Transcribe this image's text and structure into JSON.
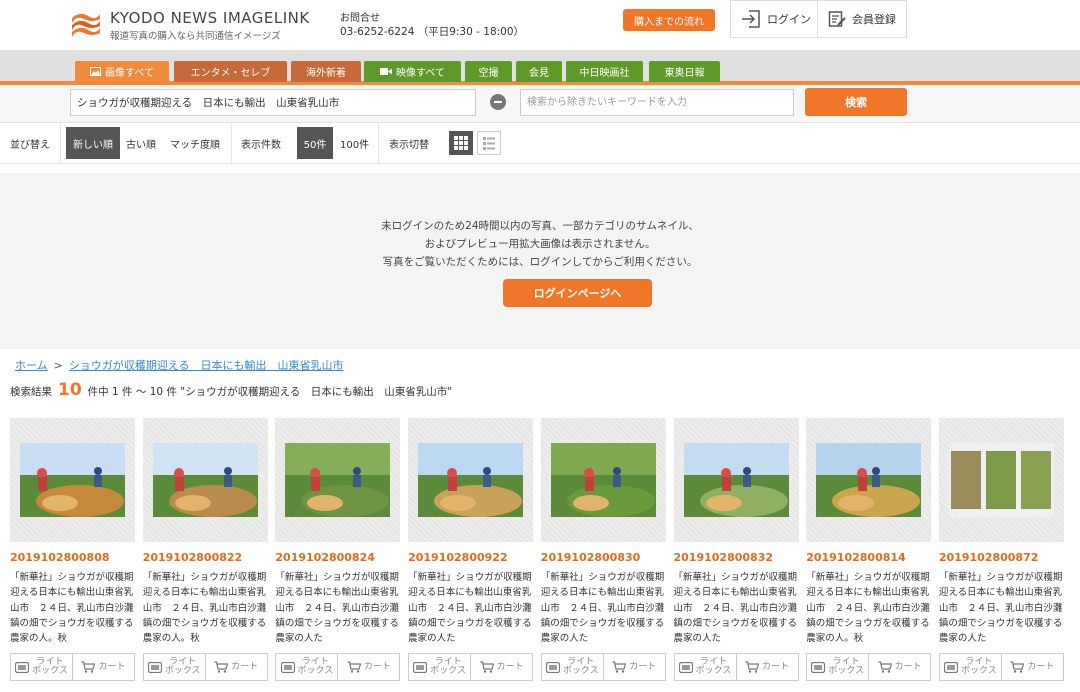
{
  "header": {
    "logo_title": "KYODO NEWS IMAGELINK",
    "logo_subtitle": "報道写真の購入なら共同通信イメージズ",
    "contact_label": "お問合せ",
    "contact_phone": "03-6252-6224 （平日9:30 - 18:00）",
    "flow_button": "購入までの流れ",
    "login": "ログイン",
    "register": "会員登録"
  },
  "categories": [
    {
      "label": "画像すべて",
      "color": "#f08a3c",
      "icon": "image-icon"
    },
    {
      "label": "エンタメ・セレブ",
      "color": "#c66a3a",
      "icon": ""
    },
    {
      "label": "海外新着",
      "color": "#c66a3a",
      "icon": ""
    },
    {
      "label": "映像すべて",
      "color": "#5d9a2a",
      "icon": "video-icon"
    },
    {
      "label": "空撮",
      "color": "#5d9a2a",
      "icon": ""
    },
    {
      "label": "会見",
      "color": "#5d9a2a",
      "icon": ""
    },
    {
      "label": "中日映画社",
      "color": "#5d9a2a",
      "icon": ""
    },
    {
      "label": "東奥日報",
      "color": "#5d9a2a",
      "icon": ""
    }
  ],
  "search": {
    "query": "ショウガが収穫期迎える　日本にも輸出　山東省乳山市",
    "exclude_placeholder": "検索から除きたいキーワードを入力",
    "button": "検索"
  },
  "sort": {
    "label": "並び替え",
    "options": [
      "新しい順",
      "古い順",
      "マッチ度順"
    ],
    "count_label": "表示件数",
    "count_options": [
      "50件",
      "100件"
    ],
    "view_label": "表示切替"
  },
  "notice": {
    "lines": [
      "未ログインのため24時間以内の写真、一部カテゴリのサムネイル、",
      "およびプレビュー用拡大画像は表示されません。",
      "写真をご覧いただくためには、ログインしてからご利用ください。"
    ],
    "button": "ログインページへ"
  },
  "breadcrumb": {
    "home": "ホーム",
    "separator": ">",
    "current": "ショウガが収穫期迎える　日本にも輸出　山東省乳山市"
  },
  "results": {
    "prefix": "検索結果",
    "count": "10",
    "suffix": "件中 1 件 ～ 10 件 \"ショウガが収穫期迎える　日本にも輸出　山東省乳山市\""
  },
  "card_actions": {
    "lightbox": "ライト\nボックス",
    "cart": "カート"
  },
  "cards": [
    {
      "id": "2019102800808",
      "caption": "「新華社」ショウガが収穫期迎える日本にも輸出山東省乳山市　２４日、乳山市白沙灘鎮の畑でショウガを収穫する農家の人。秋"
    },
    {
      "id": "2019102800822",
      "caption": "「新華社」ショウガが収穫期迎える日本にも輸出山東省乳山市　２４日、乳山市白沙灘鎮の畑でショウガを収穫する農家の人。秋"
    },
    {
      "id": "2019102800824",
      "caption": "「新華社」ショウガが収穫期迎える日本にも輸出山東省乳山市　２４日、乳山市白沙灘鎮の畑でショウガを収穫する農家の人た"
    },
    {
      "id": "2019102800922",
      "caption": "「新華社」ショウガが収穫期迎える日本にも輸出山東省乳山市　２４日、乳山市白沙灘鎮の畑でショウガを収穫する農家の人た"
    },
    {
      "id": "2019102800830",
      "caption": "「新華社」ショウガが収穫期迎える日本にも輸出山東省乳山市　２４日、乳山市白沙灘鎮の畑でショウガを収穫する農家の人た"
    },
    {
      "id": "2019102800832",
      "caption": "「新華社」ショウガが収穫期迎える日本にも輸出山東省乳山市　２４日、乳山市白沙灘鎮の畑でショウガを収穫する農家の人た"
    },
    {
      "id": "2019102800814",
      "caption": "「新華社」ショウガが収穫期迎える日本にも輸出山東省乳山市　２４日、乳山市白沙灘鎮の畑でショウガを収穫する農家の人。秋"
    },
    {
      "id": "2019102800872",
      "caption": "「新華社」ショウガが収穫期迎える日本にも輸出山東省乳山市　２４日、乳山市白沙灘鎮の畑でショウガを収穫する農家の人た"
    }
  ]
}
